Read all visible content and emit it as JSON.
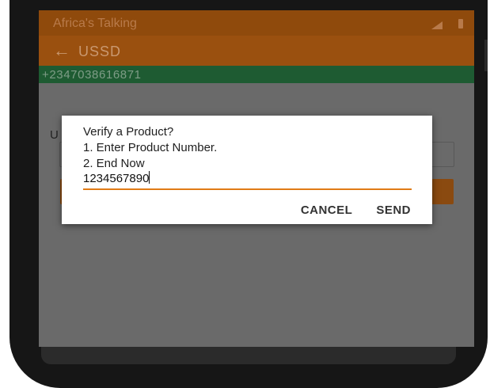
{
  "status_bar": {
    "app_name": "Africa's Talking",
    "signal_icon": "signal-icon",
    "battery_icon": "battery-icon"
  },
  "app_bar": {
    "back_icon": "←",
    "title": "USSD"
  },
  "phone_strip": {
    "number": "+2347038616871"
  },
  "background_form": {
    "label_fragment": "U"
  },
  "dialog": {
    "message_lines": [
      "Verify a Product?",
      "1. Enter Product Number.",
      "2. End Now"
    ],
    "input_value": "1234567890",
    "cancel_label": "CANCEL",
    "send_label": "SEND"
  },
  "colors": {
    "status_bar": "#8f4a0c",
    "app_bar": "#9a500f",
    "phone_strip": "#1e5b32",
    "dialog_underline": "#e07b16"
  }
}
